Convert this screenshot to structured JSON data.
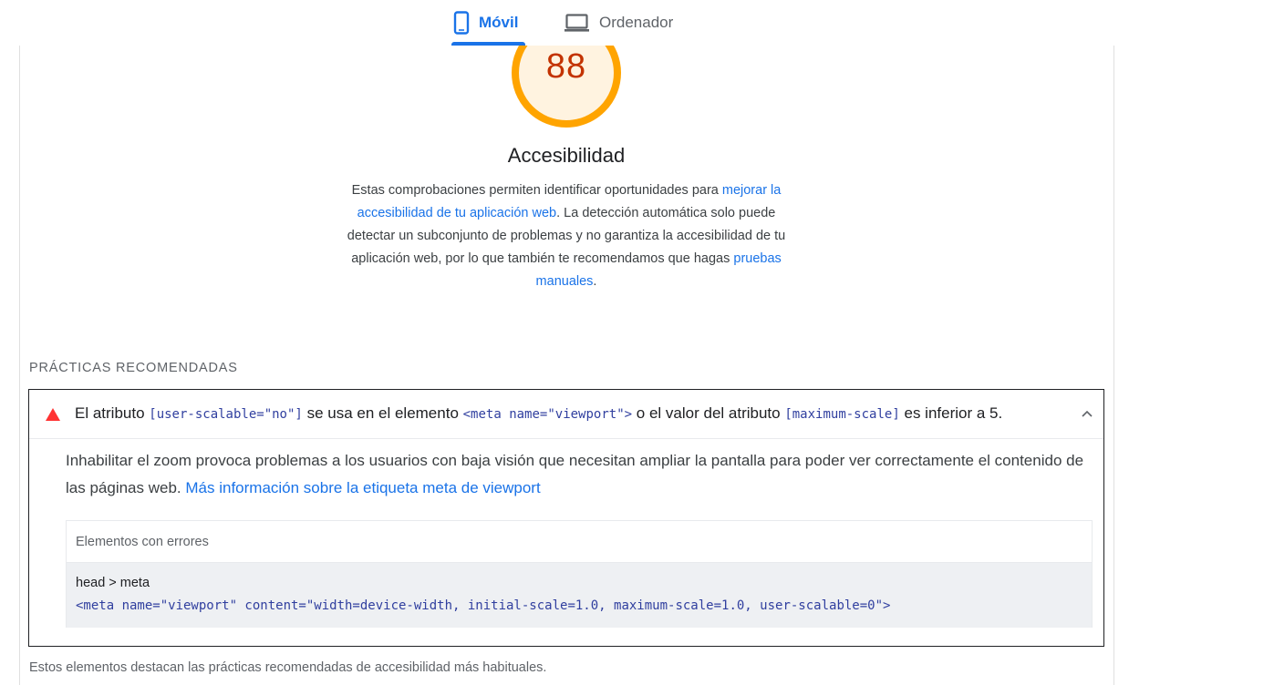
{
  "tabs": [
    {
      "label": "Móvil",
      "icon": "smartphone-icon",
      "active": true
    },
    {
      "label": "Ordenador",
      "icon": "laptop-icon",
      "active": false
    }
  ],
  "score": {
    "value": "88",
    "fraction": 0.88,
    "ring_color": "#ffa400",
    "fill_color": "#fff3e0",
    "text_color": "#c33300"
  },
  "category": {
    "title": "Accesibilidad",
    "desc_1": "Estas comprobaciones permiten identificar oportunidades para ",
    "link_1": "mejorar la accesibilidad de tu aplicación web",
    "desc_2": ". La detección automática solo puede detectar un subconjunto de problemas y no garantiza la accesibilidad de tu aplicación web, por lo que también te recomendamos que hagas ",
    "link_2": "pruebas manuales",
    "desc_3": "."
  },
  "group": {
    "title": "PRÁCTICAS RECOMENDADAS",
    "footer": "Estos elementos destacan las prácticas recomendadas de accesibilidad más habituales."
  },
  "audit": {
    "title_1": "El atributo ",
    "code_1": "[user-scalable=\"no\"]",
    "title_2": " se usa en el elemento ",
    "code_2": "<meta name=\"viewport\">",
    "title_3": " o el valor del atributo ",
    "code_3": "[maximum-scale]",
    "title_4": " es inferior a 5.",
    "description": "Inhabilitar el zoom provoca problemas a los usuarios con baja visión que necesitan ampliar la pantalla para poder ver correctamente el contenido de las páginas web. ",
    "learn_more": "Más información sobre la etiqueta meta de viewport",
    "table_header": "Elementos con errores",
    "node_path": "head > meta",
    "node_snippet": "<meta name=\"viewport\" content=\"width=device-width, initial-scale=1.0, maximum-scale=1.0, user-scalable=0\">",
    "fail_color": "#ff3333"
  }
}
